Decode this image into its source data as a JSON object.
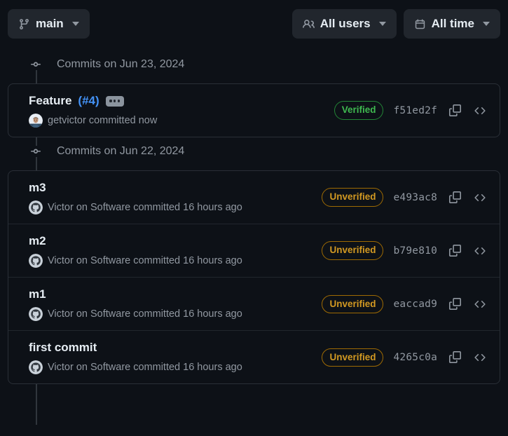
{
  "toolbar": {
    "branch_button": {
      "label": "main",
      "icon": "git-branch-icon"
    },
    "users_filter": {
      "label": "All users",
      "icon": "people-icon"
    },
    "time_filter": {
      "label": "All time",
      "icon": "calendar-icon"
    }
  },
  "colors": {
    "background": "#0d1117",
    "card_border": "#2a2f37",
    "button_background": "#21262d",
    "link": "#4493f8",
    "verified": "#3fb950",
    "verified_border": "#238636",
    "unverified": "#d29922",
    "unverified_border": "#9e6a03",
    "muted_text": "#9198a1",
    "primary_text": "#e6edf3",
    "timeline": "#30363d"
  },
  "groups": [
    {
      "header": "Commits on Jun 23, 2024",
      "commits": [
        {
          "title": "Feature",
          "pr": "(#4)",
          "pr_number": "#4",
          "has_expand_button": true,
          "avatar_type": "photo",
          "author": "getvictor",
          "meta": "getvictor committed now",
          "verification": "Verified",
          "verification_state": "verified",
          "sha": "f51ed2f",
          "copy_label": "copy-icon",
          "browse_label": "code-icon"
        }
      ]
    },
    {
      "header": "Commits on Jun 22, 2024",
      "commits": [
        {
          "title": "m3",
          "pr": "",
          "has_expand_button": false,
          "avatar_type": "github",
          "author": "Victor on Software",
          "meta": "Victor on Software committed 16 hours ago",
          "verification": "Unverified",
          "verification_state": "unverified",
          "sha": "e493ac8",
          "copy_label": "copy-icon",
          "browse_label": "code-icon"
        },
        {
          "title": "m2",
          "pr": "",
          "has_expand_button": false,
          "avatar_type": "github",
          "author": "Victor on Software",
          "meta": "Victor on Software committed 16 hours ago",
          "verification": "Unverified",
          "verification_state": "unverified",
          "sha": "b79e810",
          "copy_label": "copy-icon",
          "browse_label": "code-icon"
        },
        {
          "title": "m1",
          "pr": "",
          "has_expand_button": false,
          "avatar_type": "github",
          "author": "Victor on Software",
          "meta": "Victor on Software committed 16 hours ago",
          "verification": "Unverified",
          "verification_state": "unverified",
          "sha": "eaccad9",
          "copy_label": "copy-icon",
          "browse_label": "code-icon"
        },
        {
          "title": "first commit",
          "pr": "",
          "has_expand_button": false,
          "avatar_type": "github",
          "author": "Victor on Software",
          "meta": "Victor on Software committed 16 hours ago",
          "verification": "Unverified",
          "verification_state": "unverified",
          "sha": "4265c0a",
          "copy_label": "copy-icon",
          "browse_label": "code-icon"
        }
      ]
    }
  ]
}
